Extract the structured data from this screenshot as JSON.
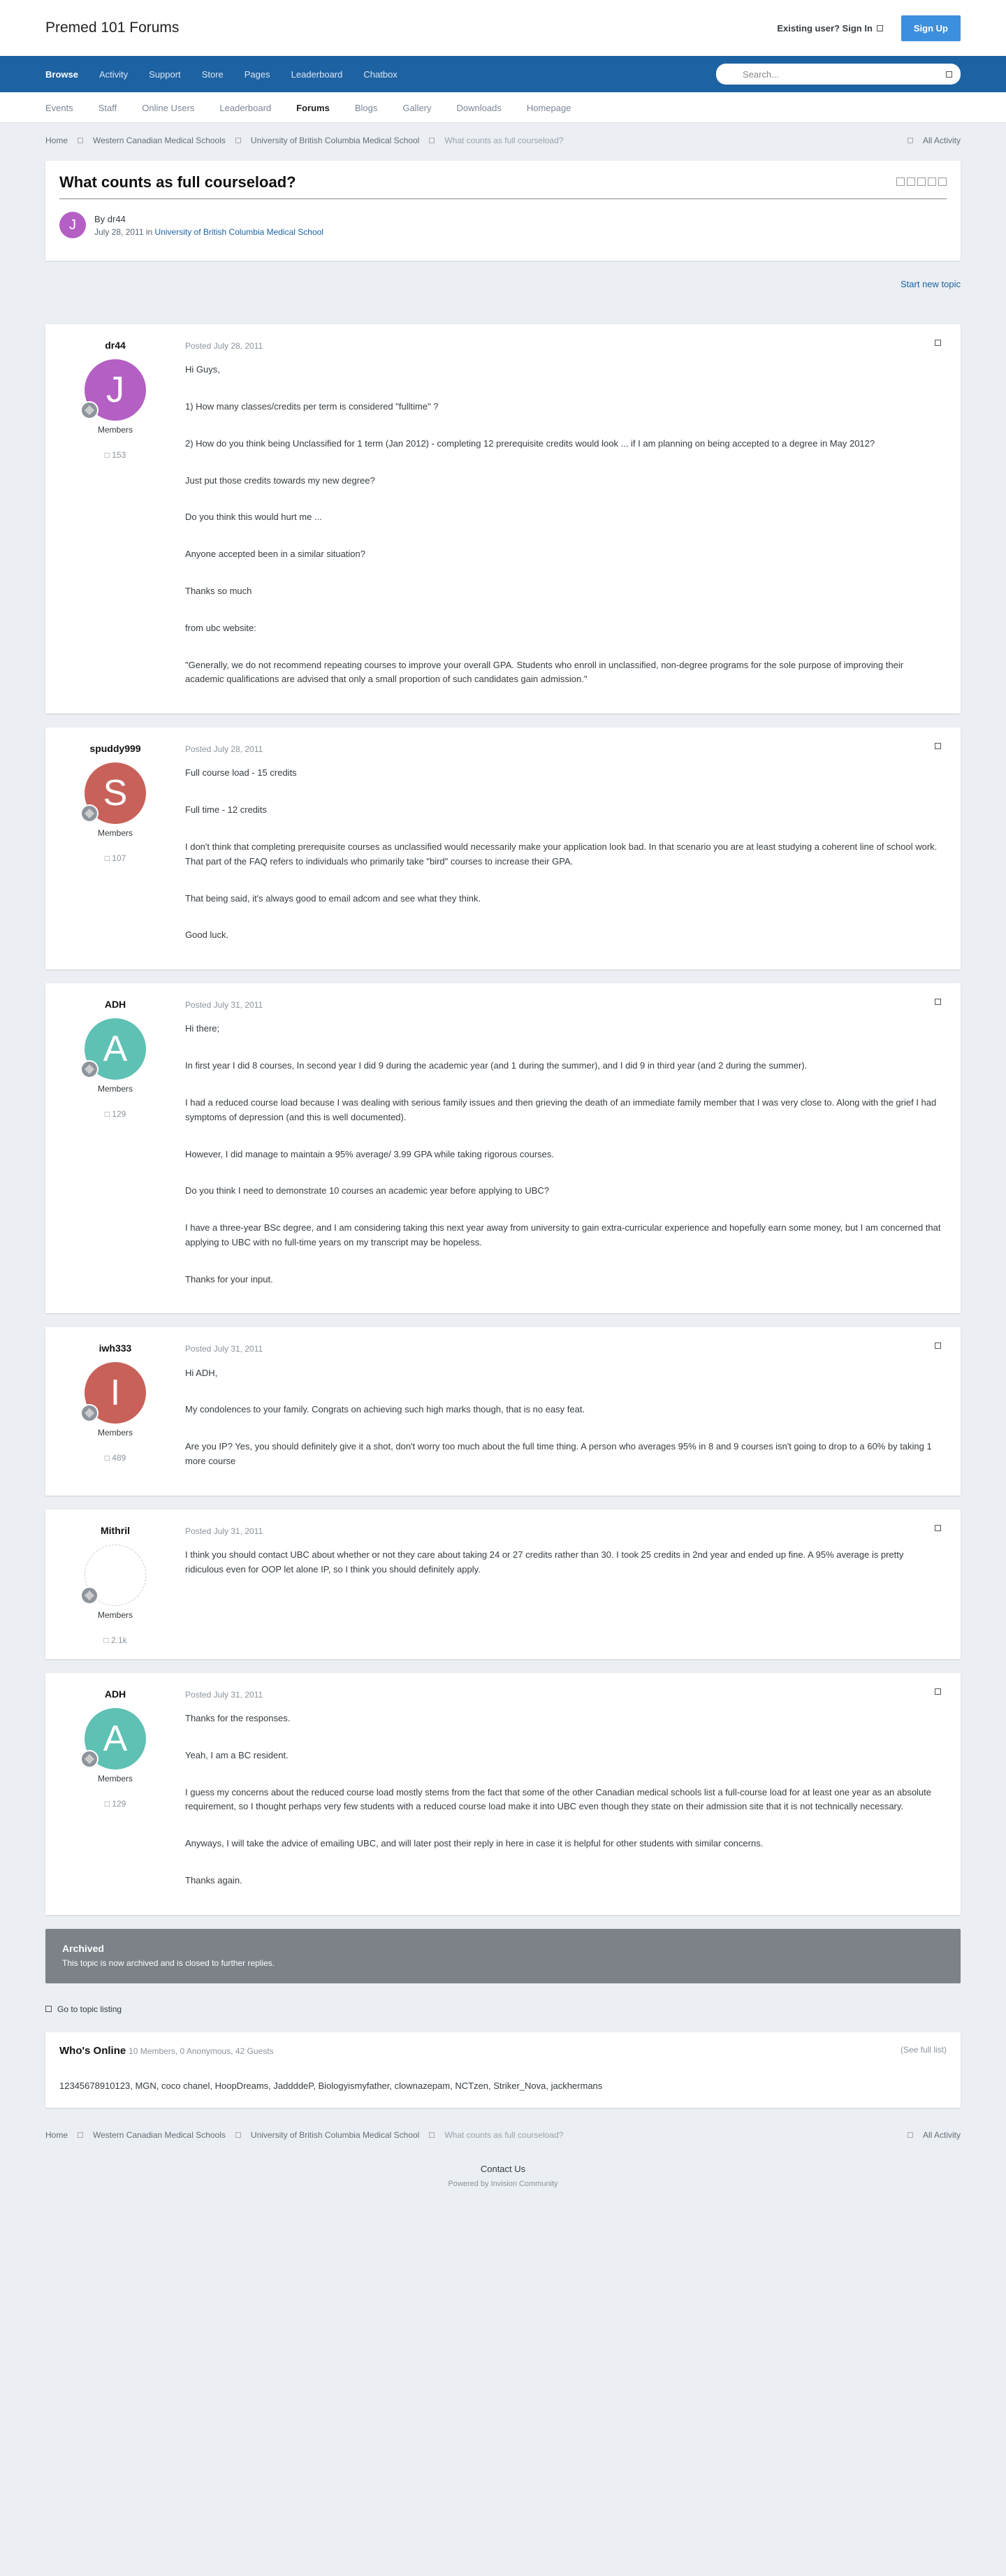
{
  "header": {
    "brand": "Premed 101 Forums",
    "signin": "Existing user? Sign In",
    "signup": "Sign Up"
  },
  "nav": {
    "items": [
      "Browse",
      "Activity",
      "Support",
      "Store",
      "Pages",
      "Leaderboard",
      "Chatbox"
    ],
    "search_placeholder": "Search..."
  },
  "subnav": {
    "items": [
      "Events",
      "Staff",
      "Online Users",
      "Leaderboard",
      "Forums",
      "Blogs",
      "Gallery",
      "Downloads",
      "Homepage"
    ]
  },
  "breadcrumb": {
    "items": [
      "Home",
      "Western Canadian Medical Schools",
      "University of British Columbia Medical School",
      "What counts as full courseload?"
    ],
    "all_activity": "All Activity"
  },
  "topic": {
    "title": "What counts as full courseload?",
    "by": "By",
    "author": "dr44",
    "date": "July 28, 2011",
    "in": "in",
    "forum": "University of British Columbia Medical School",
    "initial": "J"
  },
  "start_new_topic": "Start new topic",
  "posts": [
    {
      "author": "dr44",
      "initial": "J",
      "color": "#b45fc4",
      "group": "Members",
      "count": "153",
      "date": "Posted July 28, 2011",
      "lines": [
        "Hi Guys,",
        "1) How many classes/credits per term is considered \"fulltime\" ?",
        "2) How do you think being Unclassified for 1 term (Jan 2012) - completing 12 prerequisite credits would look ... if I am planning on being accepted to a degree in May 2012?",
        "Just put those credits towards my new degree?",
        "Do you think this would hurt me ...",
        "Anyone accepted been in a similar situation?",
        "Thanks so much",
        "from ubc website:",
        "\"Generally, we do not recommend repeating courses to improve your overall GPA. Students who enroll in unclassified, non-degree programs for the sole purpose of improving their academic qualifications are advised that only a small proportion of such candidates gain admission.\""
      ]
    },
    {
      "author": "spuddy999",
      "initial": "S",
      "color": "#c8615a",
      "group": "Members",
      "count": "107",
      "date": "Posted July 28, 2011",
      "lines": [
        "Full course load - 15 credits",
        "Full time - 12 credits",
        "I don't think that completing prerequisite courses as unclassified would necessarily make your application look bad. In that scenario you are at least studying a coherent line of school work. That part of the FAQ refers to individuals who primarily take \"bird\" courses to increase their GPA.",
        "That being said, it's always good to email adcom and see what they think.",
        "Good luck."
      ]
    },
    {
      "author": "ADH",
      "initial": "A",
      "color": "#5ec1b3",
      "group": "Members",
      "count": "129",
      "date": "Posted July 31, 2011",
      "lines": [
        "Hi there;",
        "In first year I did 8 courses, In second year I did 9 during the academic year (and 1 during the summer), and I did 9 in third year (and 2 during the summer).",
        "I had a reduced course load because I was dealing with serious family issues and then grieving the death of an immediate family member that I was very close to. Along with the grief I had symptoms of depression (and this is well documented).",
        "However, I did manage to maintain a 95% average/ 3.99 GPA while taking rigorous courses.",
        "Do you think I need to demonstrate 10 courses an academic year before applying to UBC?",
        "I have a three-year BSc degree, and I am considering taking this next year away from university to gain extra-curricular experience and hopefully earn some money, but I am concerned that applying to UBC with no full-time years on my transcript may be hopeless.",
        "Thanks for your input."
      ]
    },
    {
      "author": "iwh333",
      "initial": "I",
      "color": "#c8615a",
      "group": "Members",
      "count": "489",
      "date": "Posted July 31, 2011",
      "lines": [
        "Hi ADH,",
        "My condolences to your family. Congrats on achieving such high marks though, that is no easy feat.",
        "Are you IP? Yes, you should definitely give it a shot, don't worry too much about the full time thing. A person who averages 95% in 8 and 9 courses isn't going to drop to a 60% by taking 1 more course"
      ]
    },
    {
      "author": "Mithril",
      "initial": "",
      "color": "#ffffff",
      "group": "Members",
      "count": "2.1k",
      "date": "Posted July 31, 2011",
      "lines": [
        "I think you should contact UBC about whether or not they care about taking 24 or 27 credits rather than 30. I took 25 credits in 2nd year and ended up fine. A 95% average is pretty ridiculous even for OOP let alone IP, so I think you should definitely apply."
      ]
    },
    {
      "author": "ADH",
      "initial": "A",
      "color": "#5ec1b3",
      "group": "Members",
      "count": "129",
      "date": "Posted July 31, 2011",
      "lines": [
        "Thanks for the responses.",
        "Yeah, I am a BC resident.",
        "I guess my concerns about the reduced course load mostly stems from the fact that some of the other Canadian medical schools list a full-course load for at least one year as an absolute requirement, so I thought perhaps very few students with a reduced course load make it into UBC even though they state on their admission site that it is not technically necessary.",
        "Anyways, I will take the advice of emailing UBC, and will later post their reply in here in case it is helpful for other students with similar concerns.",
        "Thanks again."
      ]
    }
  ],
  "archived": {
    "title": "Archived",
    "text": "This topic is now archived and is closed to further replies."
  },
  "goto": "Go to topic listing",
  "online": {
    "title": "Who's Online",
    "members": "10 Members",
    "guests": ", 0 Anonymous, 42 Guests",
    "see_full": "(See full list)",
    "names": "12345678910123, MGN, coco chanel, HoopDreams, JaddddeP, Biologyismyfather, clownazepam, NCTzen, Striker_Nova, jackhermans"
  },
  "footer": {
    "contact": "Contact Us",
    "powered": "Powered by Invision Community"
  }
}
